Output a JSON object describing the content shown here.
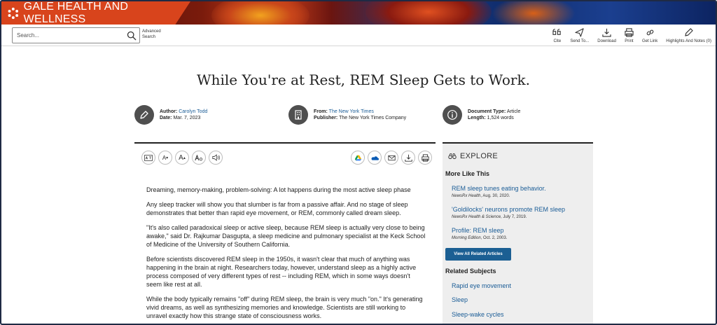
{
  "brand": {
    "name": "GALE HEALTH AND WELLNESS"
  },
  "search": {
    "placeholder": "Search...",
    "advanced_label": "Advanced Search"
  },
  "tools": [
    {
      "label": "Cite",
      "icon": "quote-icon"
    },
    {
      "label": "Send To...",
      "icon": "send-icon"
    },
    {
      "label": "Download",
      "icon": "download-icon"
    },
    {
      "label": "Print",
      "icon": "print-icon"
    },
    {
      "label": "Get Link",
      "icon": "link-icon"
    },
    {
      "label": "Highlights And Notes (0)",
      "icon": "pencil-icon"
    }
  ],
  "document": {
    "title": "While You're at Rest, REM Sleep Gets to Work.",
    "author_label": "Author:",
    "author": "Carolyn Todd",
    "date_label": "Date:",
    "date": "Mar. 7, 2023",
    "from_label": "From:",
    "from": "The New York Times",
    "publisher_label": "Publisher:",
    "publisher": "The New York Times Company",
    "type_label": "Document Type:",
    "type": "Article",
    "length_label": "Length:",
    "length": "1,524 words"
  },
  "reader": {
    "text_size_small": "A",
    "text_size_large": "A"
  },
  "article": {
    "paragraphs": [
      "Dreaming, memory-making, problem-solving: A lot happens during the most active sleep phase",
      "Any sleep tracker will show you that slumber is far from a passive affair. And no stage of sleep demonstrates that better than rapid eye movement, or REM, commonly called dream sleep.",
      "\"It's also called paradoxical sleep or active sleep, because REM sleep is actually very close to being awake,\" said Dr. Rajkumar Dasgupta, a sleep medicine and pulmonary specialist at the Keck School of Medicine of the University of Southern California.",
      "Before scientists discovered REM sleep in the 1950s, it wasn't clear that much of anything was happening in the brain at night. Researchers today, however, understand sleep as a highly active process composed of very different types of rest -- including REM, which in some ways doesn't seem like rest at all.",
      "While the body typically remains \"off\" during REM sleep, the brain is very much \"on.\" It's generating vivid dreams, as well as synthesizing memories and knowledge. Scientists are still working to unravel exactly how this strange state of consciousness works."
    ]
  },
  "explore": {
    "heading": "EXPLORE",
    "more_like_this": "More Like This",
    "items": [
      {
        "title": "REM sleep tunes eating behavior.",
        "source": "NewsRx Health",
        "date": ", Aug. 30, 2020."
      },
      {
        "title": "'Goldilocks' neurons promote REM sleep",
        "source": "NewsRx Health & Science",
        "date": ", July 7, 2019."
      },
      {
        "title": "Profile: REM sleep",
        "source": "Morning Edition",
        "date": ", Oct. 2, 2003."
      }
    ],
    "view_all": "View All Related Articles",
    "related_subjects": "Related Subjects",
    "subjects": [
      "Rapid eye movement",
      "Sleep",
      "Sleep-wake cycles"
    ]
  },
  "colors": {
    "brand_orange": "#d8441c",
    "link_blue": "#1a5c96",
    "button_blue": "#1b5f93"
  }
}
